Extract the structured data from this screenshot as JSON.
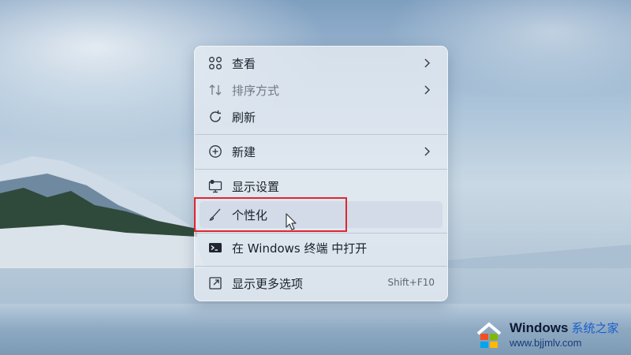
{
  "context_menu": {
    "items": [
      {
        "label": "查看",
        "icon": "grid-icon",
        "has_submenu": true
      },
      {
        "label": "排序方式",
        "icon": "sort-icon",
        "has_submenu": true,
        "disabled": true
      },
      {
        "label": "刷新",
        "icon": "refresh-icon"
      },
      {
        "label": "新建",
        "icon": "new-plus-icon",
        "has_submenu": true
      },
      {
        "label": "显示设置",
        "icon": "display-settings-icon"
      },
      {
        "label": "个性化",
        "icon": "brush-icon",
        "highlighted": true
      },
      {
        "label": "在 Windows 终端 中打开",
        "icon": "terminal-icon"
      },
      {
        "label": "显示更多选项",
        "icon": "more-options-icon",
        "shortcut": "Shift+F10"
      }
    ]
  },
  "annotation": {
    "highlight_color": "#e0262f"
  },
  "watermark": {
    "brand": "Windows",
    "brand_cn": "系统之家",
    "url": "www.bjjmlv.com"
  }
}
